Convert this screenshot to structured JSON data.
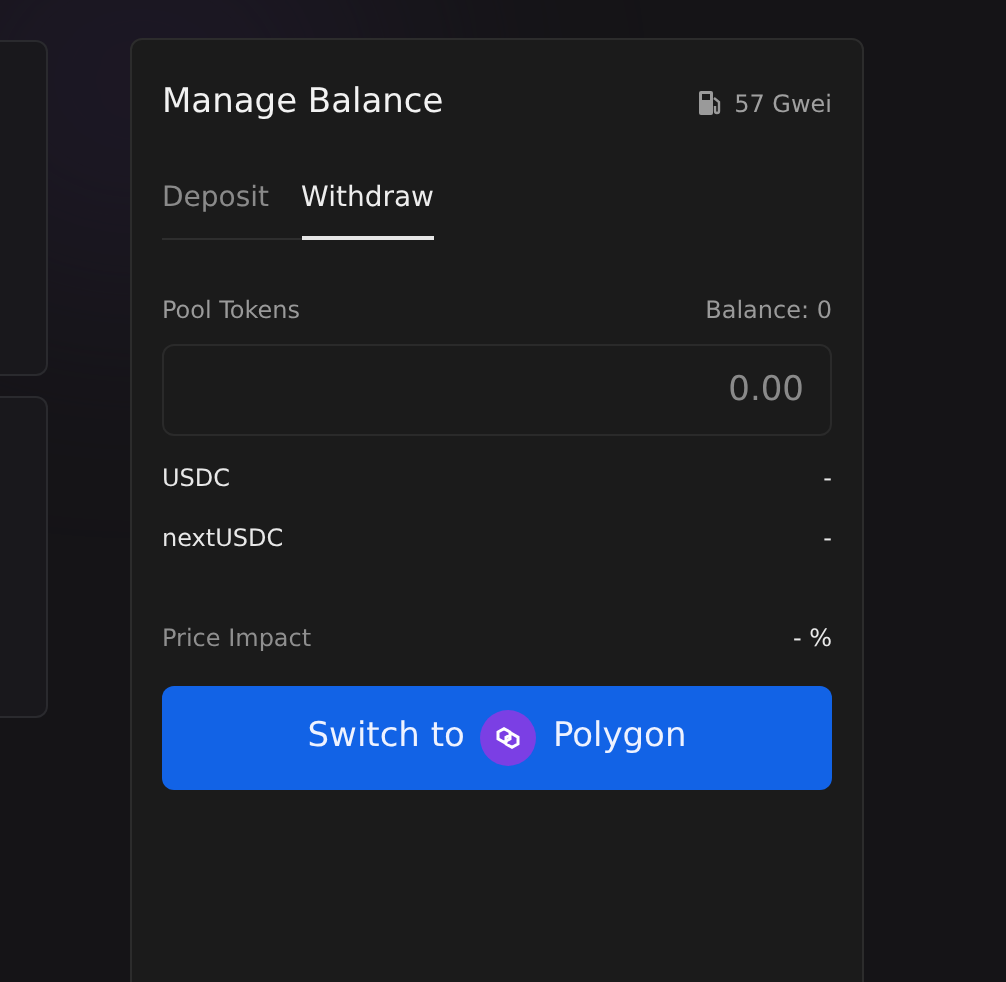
{
  "card": {
    "title": "Manage Balance",
    "gas": "57 Gwei"
  },
  "tabs": [
    {
      "label": "Deposit",
      "selected": false
    },
    {
      "label": "Withdraw",
      "selected": true
    }
  ],
  "pool_tokens": {
    "label": "Pool Tokens",
    "balance": "Balance: 0",
    "placeholder": "0.00"
  },
  "assets": [
    {
      "name": "USDC",
      "value": "-"
    },
    {
      "name": "nextUSDC",
      "value": "-"
    }
  ],
  "price_impact": {
    "label": "Price Impact",
    "value": "- %"
  },
  "button": {
    "prefix": "Switch to",
    "network": "Polygon"
  }
}
